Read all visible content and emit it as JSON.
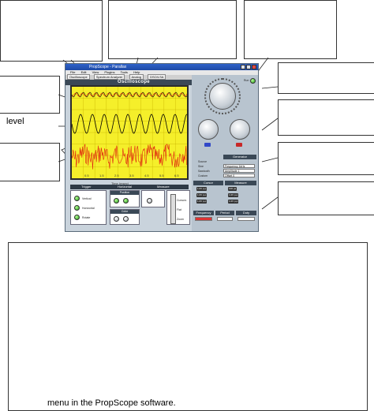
{
  "page_text": {
    "level_label": "level",
    "caption": "menu in the PropScope software."
  },
  "app": {
    "window_title": "PropScope - Parallax",
    "menu": [
      "File",
      "Edit",
      "View",
      "Plugins",
      "Tools",
      "Help"
    ],
    "tabs": [
      "Oscilloscope",
      "Spectrum Analyzer",
      "Analog",
      "DSO/LSA"
    ],
    "scope_title": "Oscilloscope",
    "time_axis_label": "Time (msec)",
    "bottom_tabs": [
      "Trigger",
      "Horizontal",
      "Measure"
    ],
    "trigger": {
      "options": [
        "Vertical",
        "Horizontal",
        "Rotate"
      ]
    },
    "position_label": "Position",
    "color_label": "Color",
    "cursor_options": [
      "Cursors",
      "Flat",
      "Zoom"
    ],
    "right_panel": {
      "run_label": "Run",
      "generator_header": "Generator",
      "generator_fields": [
        {
          "label": "Source",
          "value": ""
        },
        {
          "label": "Sine",
          "value": "Frequency 1kHz"
        },
        {
          "label": "Sawtooth",
          "value": "Amplitude 1"
        },
        {
          "label": "Custom",
          "value": "Offset 0"
        }
      ],
      "cursor_header": "Cursor",
      "measure_header": "Measure",
      "readouts": [
        "1.0V p-p",
        "1.0V p-p",
        "1.0V p-p",
        "100 µs"
      ],
      "stats": [
        "Frequency",
        "Period",
        "Duty"
      ]
    },
    "colors": {
      "plot_bg": "#f5ef2a",
      "sine": "#000000",
      "noise": "#e02010",
      "panel": "#b8c4cf"
    }
  },
  "chart_data": {
    "type": "line",
    "series": [
      {
        "values": []
      },
      {
        "values": []
      },
      {
        "values": []
      }
    ],
    "x_tick_labels": [
      "0.5",
      "1.5",
      "2.5",
      "3.5",
      "4.5",
      "5.5",
      "6.5"
    ],
    "xlabel": "Time (msec)",
    "grid": true
  }
}
